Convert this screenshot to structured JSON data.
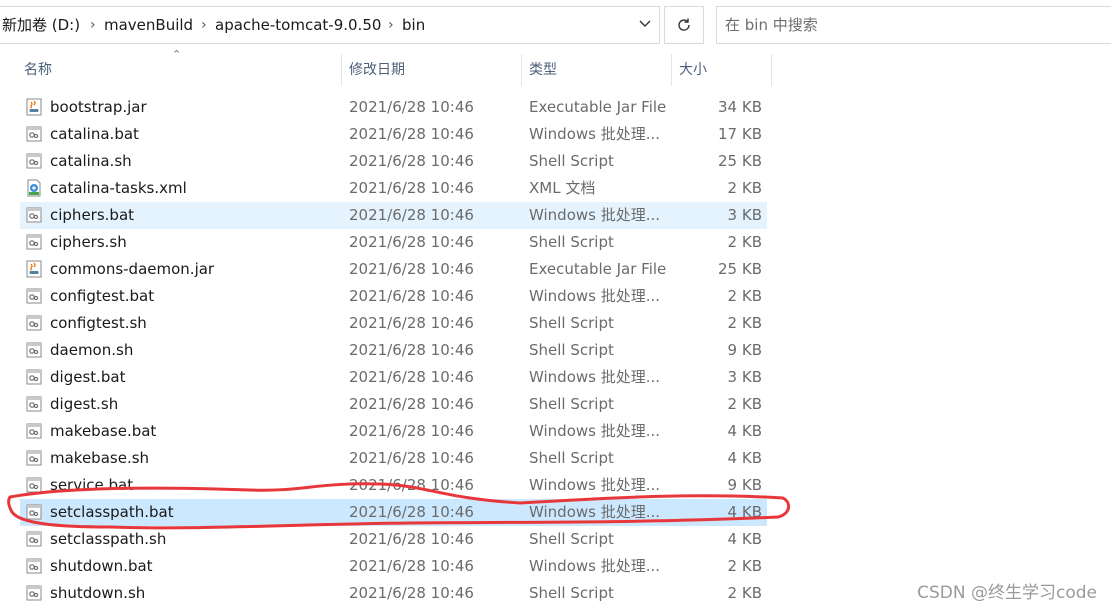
{
  "breadcrumb": {
    "items": [
      "新加卷 (D:)",
      "mavenBuild",
      "apache-tomcat-9.0.50",
      "bin"
    ]
  },
  "search": {
    "placeholder": "在 bin 中搜索"
  },
  "columns": {
    "name": "名称",
    "date": "修改日期",
    "type": "类型",
    "size": "大小"
  },
  "files": [
    {
      "name": "bootstrap.jar",
      "date": "2021/6/28 10:46",
      "type": "Executable Jar File",
      "size": "34 KB",
      "icon": "jar-icon"
    },
    {
      "name": "catalina.bat",
      "date": "2021/6/28 10:46",
      "type": "Windows 批处理...",
      "size": "17 KB",
      "icon": "batch-file-icon"
    },
    {
      "name": "catalina.sh",
      "date": "2021/6/28 10:46",
      "type": "Shell Script",
      "size": "25 KB",
      "icon": "shell-file-icon"
    },
    {
      "name": "catalina-tasks.xml",
      "date": "2021/6/28 10:46",
      "type": "XML 文档",
      "size": "2 KB",
      "icon": "xml-file-icon"
    },
    {
      "name": "ciphers.bat",
      "date": "2021/6/28 10:46",
      "type": "Windows 批处理...",
      "size": "3 KB",
      "icon": "batch-file-icon"
    },
    {
      "name": "ciphers.sh",
      "date": "2021/6/28 10:46",
      "type": "Shell Script",
      "size": "2 KB",
      "icon": "shell-file-icon"
    },
    {
      "name": "commons-daemon.jar",
      "date": "2021/6/28 10:46",
      "type": "Executable Jar File",
      "size": "25 KB",
      "icon": "jar-icon"
    },
    {
      "name": "configtest.bat",
      "date": "2021/6/28 10:46",
      "type": "Windows 批处理...",
      "size": "2 KB",
      "icon": "batch-file-icon"
    },
    {
      "name": "configtest.sh",
      "date": "2021/6/28 10:46",
      "type": "Shell Script",
      "size": "2 KB",
      "icon": "shell-file-icon"
    },
    {
      "name": "daemon.sh",
      "date": "2021/6/28 10:46",
      "type": "Shell Script",
      "size": "9 KB",
      "icon": "shell-file-icon"
    },
    {
      "name": "digest.bat",
      "date": "2021/6/28 10:46",
      "type": "Windows 批处理...",
      "size": "3 KB",
      "icon": "batch-file-icon"
    },
    {
      "name": "digest.sh",
      "date": "2021/6/28 10:46",
      "type": "Shell Script",
      "size": "2 KB",
      "icon": "shell-file-icon"
    },
    {
      "name": "makebase.bat",
      "date": "2021/6/28 10:46",
      "type": "Windows 批处理...",
      "size": "4 KB",
      "icon": "batch-file-icon"
    },
    {
      "name": "makebase.sh",
      "date": "2021/6/28 10:46",
      "type": "Shell Script",
      "size": "4 KB",
      "icon": "shell-file-icon"
    },
    {
      "name": "service.bat",
      "date": "2021/6/28 10:46",
      "type": "Windows 批处理...",
      "size": "9 KB",
      "icon": "batch-file-icon"
    },
    {
      "name": "setclasspath.bat",
      "date": "2021/6/28 10:46",
      "type": "Windows 批处理...",
      "size": "4 KB",
      "icon": "batch-file-icon"
    },
    {
      "name": "setclasspath.sh",
      "date": "2021/6/28 10:46",
      "type": "Shell Script",
      "size": "4 KB",
      "icon": "shell-file-icon"
    },
    {
      "name": "shutdown.bat",
      "date": "2021/6/28 10:46",
      "type": "Windows 批处理...",
      "size": "2 KB",
      "icon": "batch-file-icon"
    },
    {
      "name": "shutdown.sh",
      "date": "2021/6/28 10:46",
      "type": "Shell Script",
      "size": "2 KB",
      "icon": "shell-file-icon"
    }
  ],
  "selected_row": 15,
  "hover_row": 4,
  "watermark": "CSDN @终生学习code",
  "colors": {
    "selection": "#cce8ff",
    "hover": "#e5f3ff",
    "annotation": "#e8373b",
    "header_text": "#4c607a"
  }
}
